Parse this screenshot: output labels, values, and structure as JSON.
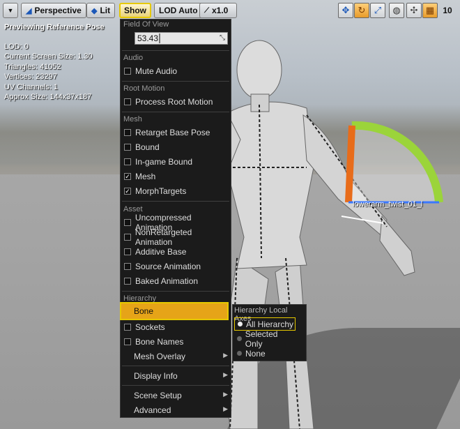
{
  "toolbar": {
    "dropdown_icon": "chevron-down-icon",
    "perspective_label": "Perspective",
    "lit_label": "Lit",
    "show_label": "Show",
    "lod_label": "LOD Auto",
    "speed_label": "x1.0",
    "right_icons": [
      "move-icon",
      "rotate-icon",
      "scale-icon",
      "globe-icon",
      "snap-icon",
      "grid-icon"
    ],
    "grid_value": "10"
  },
  "stats": {
    "header": "Previewing Reference Pose",
    "lines": [
      "LOD: 0",
      "Current Screen Size: 1.30",
      "Triangles: 41052",
      "Vertices: 23297",
      "UV Channels: 1",
      "Approx Size: 144x37x187"
    ]
  },
  "viewport": {
    "bone_label": "lowerarm_twist_01_l"
  },
  "menu": {
    "fov_section": "Field Of View",
    "fov_value": "53.43",
    "audio_section": "Audio",
    "mute_audio": "Mute Audio",
    "root_motion_section": "Root Motion",
    "process_root_motion": "Process Root Motion",
    "mesh_section": "Mesh",
    "retarget_base_pose": "Retarget Base Pose",
    "bound": "Bound",
    "in_game_bound": "In-game Bound",
    "mesh": "Mesh",
    "morph_targets": "MorphTargets",
    "asset_section": "Asset",
    "uncompressed_animation": "Uncompressed Animation",
    "nonretargeted_animation": "NonRetargeted Animation",
    "additive_base": "Additive Base",
    "source_animation": "Source Animation",
    "baked_animation": "Baked Animation",
    "hierarchy_section": "Hierarchy",
    "bone": "Bone",
    "sockets": "Sockets",
    "bone_names": "Bone Names",
    "mesh_overlay": "Mesh Overlay",
    "display_info": "Display Info",
    "scene_setup": "Scene Setup",
    "advanced": "Advanced",
    "checked": {
      "mesh": true,
      "morph_targets": true
    }
  },
  "submenu": {
    "title": "Hierarchy Local Axes",
    "options": [
      "All Hierarchy",
      "Selected Only",
      "None"
    ],
    "selected": "All Hierarchy"
  }
}
